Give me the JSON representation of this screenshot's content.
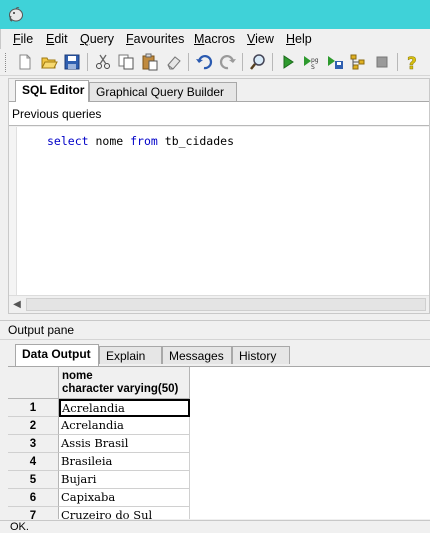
{
  "menu": {
    "items": [
      {
        "underline": "F",
        "rest": "ile"
      },
      {
        "underline": "E",
        "rest": "dit"
      },
      {
        "underline": "Q",
        "rest": "uery"
      },
      {
        "underline": "F",
        "rest": "avourites"
      },
      {
        "underline": "M",
        "rest": "acros"
      },
      {
        "underline": "V",
        "rest": "iew"
      },
      {
        "underline": "H",
        "rest": "elp"
      }
    ]
  },
  "toolbar": {
    "icons": [
      "new-icon",
      "open-icon",
      "save-icon",
      "cut-icon",
      "copy-icon",
      "paste-icon",
      "clear-icon",
      "undo-icon",
      "redo-icon",
      "find-icon",
      "execute-icon",
      "execute-pgscript-icon",
      "execute-to-file-icon",
      "explain-icon",
      "cancel-icon",
      "help-icon"
    ]
  },
  "editor": {
    "tabs": [
      "SQL Editor",
      "Graphical Query Builder"
    ],
    "active_tab": "SQL Editor",
    "previous_queries_label": "Previous queries",
    "sql": {
      "kw_select": "select",
      "ident_nome": "nome",
      "kw_from": "from",
      "ident_table": "tb_cidades"
    }
  },
  "output": {
    "title": "Output pane",
    "tabs": [
      "Data Output",
      "Explain",
      "Messages",
      "History"
    ],
    "active_tab": "Data Output",
    "columns": [
      {
        "name": "nome",
        "type": "character varying(50)"
      }
    ],
    "rows": [
      {
        "num": "1",
        "nome": "Acrelandia"
      },
      {
        "num": "2",
        "nome": "Acrelandia"
      },
      {
        "num": "3",
        "nome": "Assis Brasil"
      },
      {
        "num": "4",
        "nome": "Brasileia"
      },
      {
        "num": "5",
        "nome": "Bujari"
      },
      {
        "num": "6",
        "nome": "Capixaba"
      },
      {
        "num": "7",
        "nome": "Cruzeiro do Sul"
      }
    ]
  },
  "status": {
    "text": "OK."
  }
}
